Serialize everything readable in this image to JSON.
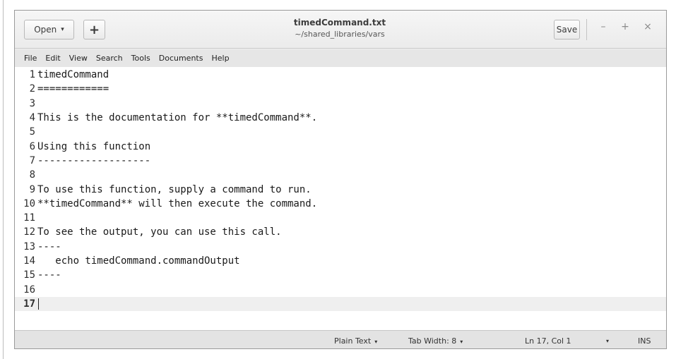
{
  "header": {
    "open_label": "Open",
    "open_caret": "▾",
    "new_tab_symbol": "+",
    "title": "timedCommand.txt",
    "subtitle": "~/shared_libraries/vars",
    "save_label": "Save",
    "minimize_symbol": "–",
    "maximize_symbol": "+",
    "close_symbol": "×"
  },
  "menu": [
    "File",
    "Edit",
    "View",
    "Search",
    "Tools",
    "Documents",
    "Help"
  ],
  "editor": {
    "lines": [
      {
        "num": "1",
        "text": "timedCommand"
      },
      {
        "num": "2",
        "text": "============"
      },
      {
        "num": "3",
        "text": ""
      },
      {
        "num": "4",
        "text": "This is the documentation for **timedCommand**."
      },
      {
        "num": "5",
        "text": ""
      },
      {
        "num": "6",
        "text": "Using this function"
      },
      {
        "num": "7",
        "text": "-------------------"
      },
      {
        "num": "8",
        "text": ""
      },
      {
        "num": "9",
        "text": "To use this function, supply a command to run."
      },
      {
        "num": "10",
        "text": "**timedCommand** will then execute the command."
      },
      {
        "num": "11",
        "text": ""
      },
      {
        "num": "12",
        "text": "To see the output, you can use this call."
      },
      {
        "num": "13",
        "text": "----"
      },
      {
        "num": "14",
        "text": "   echo timedCommand.commandOutput"
      },
      {
        "num": "15",
        "text": "----"
      },
      {
        "num": "16",
        "text": ""
      },
      {
        "num": "17",
        "text": ""
      }
    ],
    "current_line": "17"
  },
  "status": {
    "language": "Plain Text",
    "tab_width": "Tab Width: 8",
    "position": "Ln 17, Col 1",
    "mode": "INS",
    "dropdown_caret": "▾"
  }
}
